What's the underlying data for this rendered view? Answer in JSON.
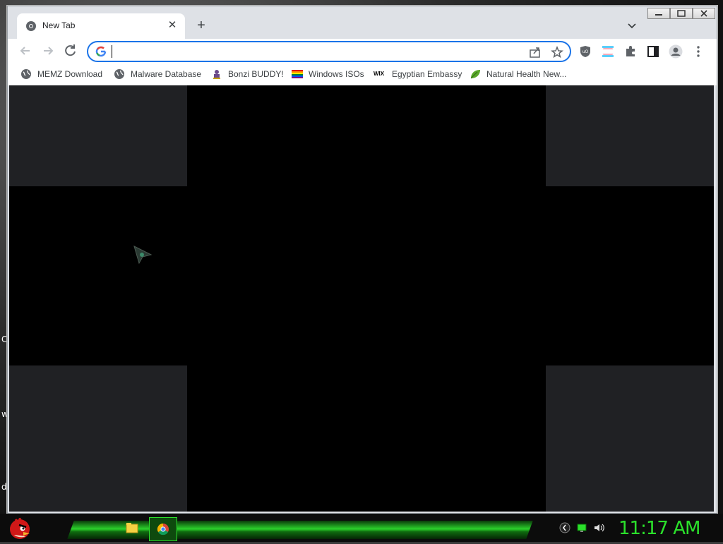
{
  "desktop": {
    "side_letters": [
      "C",
      "w",
      "d"
    ]
  },
  "browser": {
    "tab": {
      "title": "New Tab",
      "close": "✕"
    },
    "new_tab_symbol": "+",
    "tab_search_icon": "chevron-down-icon",
    "address_bar": {
      "value": "",
      "placeholder": ""
    },
    "bookmarks": [
      {
        "label": "MEMZ Download",
        "icon": "globe-icon"
      },
      {
        "label": "Malware Database",
        "icon": "globe-icon"
      },
      {
        "label": "Bonzi BUDDY!",
        "icon": "bonzi-icon"
      },
      {
        "label": "Windows ISOs",
        "icon": "rainbow-flag-icon"
      },
      {
        "label": "Egyptian Embassy",
        "icon": "wix-icon"
      },
      {
        "label": "Natural Health New...",
        "icon": "leaf-icon"
      }
    ],
    "wix_text": "WIX"
  },
  "taskbar": {
    "clock": "11:17 AM"
  },
  "colors": {
    "accent": "#1a73e8",
    "clock": "#2be02b",
    "panel": "#202124"
  }
}
